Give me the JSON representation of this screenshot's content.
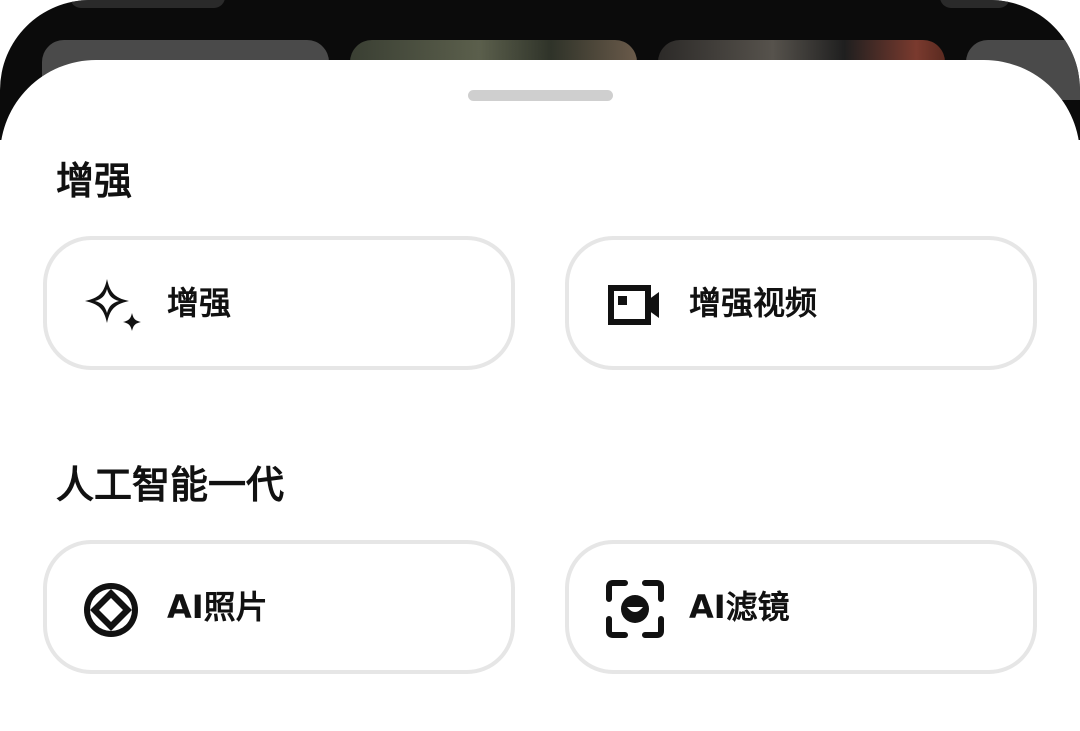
{
  "sections": [
    {
      "title": "增强",
      "buttons": [
        {
          "label": "增强",
          "icon": "sparkle-icon"
        },
        {
          "label": "增强视频",
          "icon": "video-camera-icon"
        }
      ]
    },
    {
      "title": "人工智能一代",
      "buttons": [
        {
          "label": "AI照片",
          "icon": "diamond-circle-icon"
        },
        {
          "label": "AI滤镜",
          "icon": "face-scan-icon"
        }
      ]
    }
  ],
  "colors": {
    "background": "#0b0b0b",
    "sheet": "#ffffff",
    "button_border": "#e6e6e6",
    "text": "#111111",
    "handle": "#cfcfcf"
  }
}
